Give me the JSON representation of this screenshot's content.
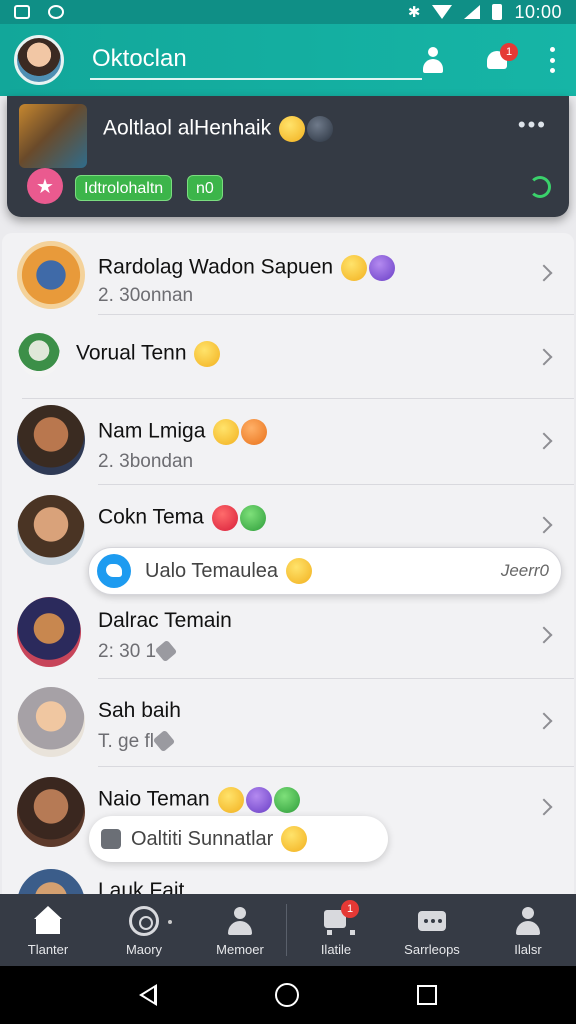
{
  "status_bar": {
    "time": "10:00"
  },
  "app_bar": {
    "search_value": "Oktoclan",
    "notification_count": "1"
  },
  "pinned": {
    "title": "Aoltlaol alHenhaik",
    "more": "•••",
    "star": "★",
    "chips": [
      "Idtrolohaltn",
      "n0"
    ]
  },
  "chats": [
    {
      "name": "Rardolag Wadon Sapuen",
      "subtitle": "2. 30onnan"
    },
    {
      "name": "Vorual Tenn",
      "subtitle": ""
    },
    {
      "name": "Nam Lmiga",
      "subtitle": "2. 3bondan"
    },
    {
      "name": "Cokn Tema",
      "subtitle": ""
    },
    {
      "name": "Dalrac Temain",
      "subtitle": "2: 30 1"
    },
    {
      "name": "Sah baih",
      "subtitle": "T. ge fl"
    },
    {
      "name": "Naio Teman",
      "subtitle": ""
    },
    {
      "name": "Lauk Fait",
      "subtitle": ""
    }
  ],
  "popups": {
    "reply_text": "Ualo Temaulea",
    "reply_meta": "Jeerr0",
    "status_text": "Oaltiti Sunnatlar"
  },
  "bottom_nav": {
    "items": [
      {
        "label": "Tlanter",
        "icon": "home-icon"
      },
      {
        "label": "Maory",
        "icon": "ball-icon"
      },
      {
        "label": "Memoer",
        "icon": "user-icon"
      },
      {
        "label": "Ilatile",
        "icon": "cart-icon"
      },
      {
        "label": "Sarrleops",
        "icon": "chat-icon"
      },
      {
        "label": "Ilalsr",
        "icon": "person-icon"
      }
    ],
    "badge": "1"
  }
}
